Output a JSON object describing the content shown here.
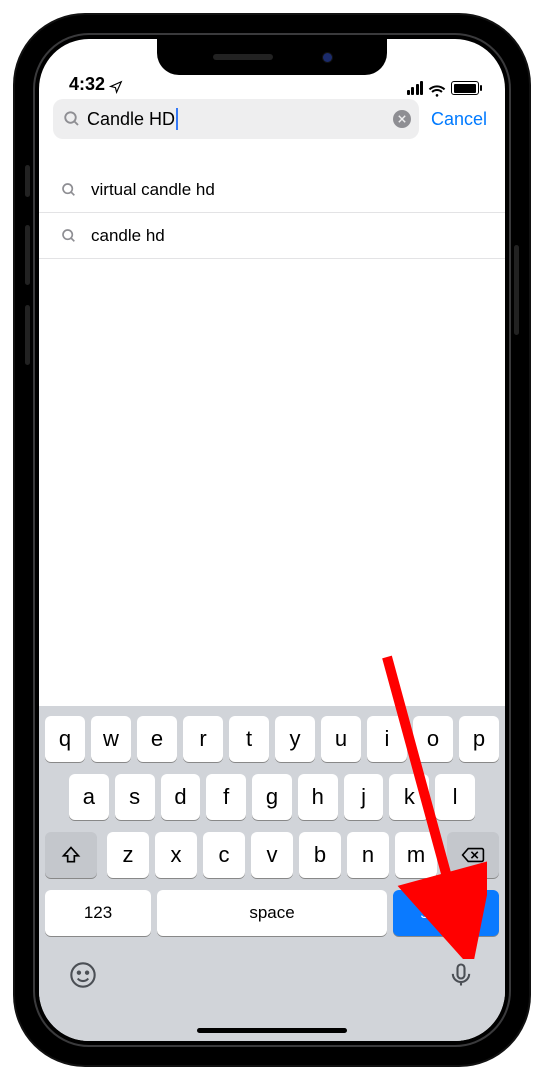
{
  "statusbar": {
    "time": "4:32"
  },
  "search": {
    "value": "Candle HD",
    "cancel_label": "Cancel"
  },
  "suggestions": [
    {
      "label": "virtual candle hd"
    },
    {
      "label": "candle hd"
    }
  ],
  "keyboard": {
    "row1": [
      "q",
      "w",
      "e",
      "r",
      "t",
      "y",
      "u",
      "i",
      "o",
      "p"
    ],
    "row2": [
      "a",
      "s",
      "d",
      "f",
      "g",
      "h",
      "j",
      "k",
      "l"
    ],
    "row3": [
      "z",
      "x",
      "c",
      "v",
      "b",
      "n",
      "m"
    ],
    "key_numbers": "123",
    "key_space": "space",
    "key_search": "search"
  }
}
